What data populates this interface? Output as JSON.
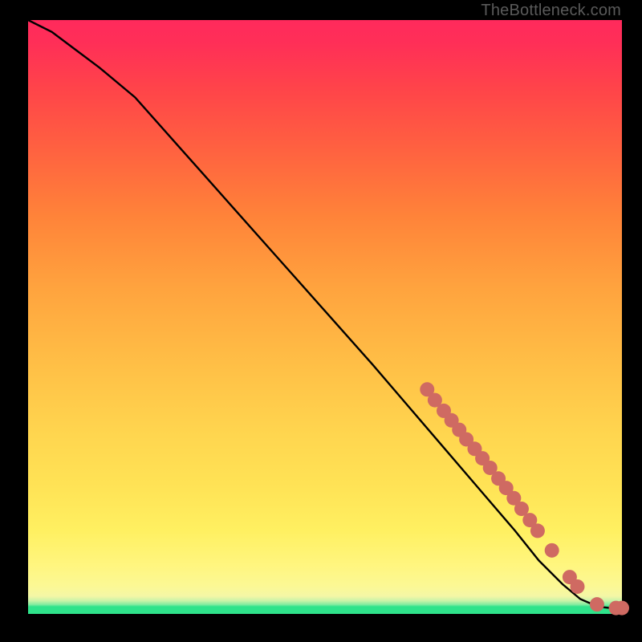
{
  "watermark": "TheBottleneck.com",
  "chart_data": {
    "type": "line",
    "title": "",
    "xlabel": "",
    "ylabel": "",
    "xlim": [
      0,
      100
    ],
    "ylim": [
      0,
      100
    ],
    "curve": {
      "x": [
        0,
        4,
        8,
        12,
        18,
        26,
        34,
        42,
        50,
        58,
        64,
        70,
        76,
        82,
        86,
        90,
        93,
        96,
        98,
        100
      ],
      "y": [
        100,
        98,
        95,
        92,
        87,
        78,
        69,
        60,
        51,
        42,
        35,
        28,
        21,
        14,
        9,
        5,
        2.5,
        1.2,
        1,
        1
      ]
    },
    "points": {
      "x": [
        67.2,
        68.5,
        70.0,
        71.3,
        72.6,
        73.8,
        75.2,
        76.5,
        77.8,
        79.2,
        80.5,
        81.8,
        83.1,
        84.5,
        85.8,
        88.2,
        91.2,
        92.5,
        95.8,
        99.0,
        100.0
      ],
      "y": [
        37.8,
        36.0,
        34.2,
        32.6,
        31.0,
        29.4,
        27.8,
        26.2,
        24.6,
        22.8,
        21.2,
        19.5,
        17.7,
        15.8,
        14.0,
        10.7,
        6.2,
        4.6,
        1.6,
        1.0,
        1.0
      ]
    }
  }
}
